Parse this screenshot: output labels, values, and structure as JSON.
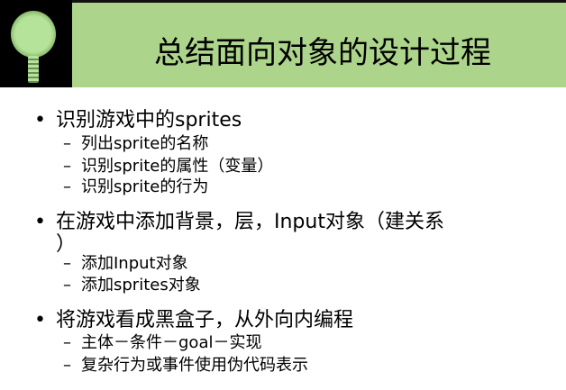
{
  "title": "总结面向对象的设计过程",
  "bullets": [
    {
      "text": "识别游戏中的sprites",
      "sub": [
        "列出sprite的名称",
        "识别sprite的属性（变量）",
        "识别sprite的行为"
      ]
    },
    {
      "text": "在游戏中添加背景，层，Input对象（建关系",
      "cont": "）",
      "sub": [
        "添加Input对象",
        "添加sprites对象"
      ]
    },
    {
      "text": "将游戏看成黑盒子，从外向内编程",
      "sub": [
        "主体－条件－goal－实现",
        "复杂行为或事件使用伪代码表示"
      ]
    }
  ],
  "bullet_char": "•",
  "dash_char": "–",
  "header_color": "#acd48a"
}
